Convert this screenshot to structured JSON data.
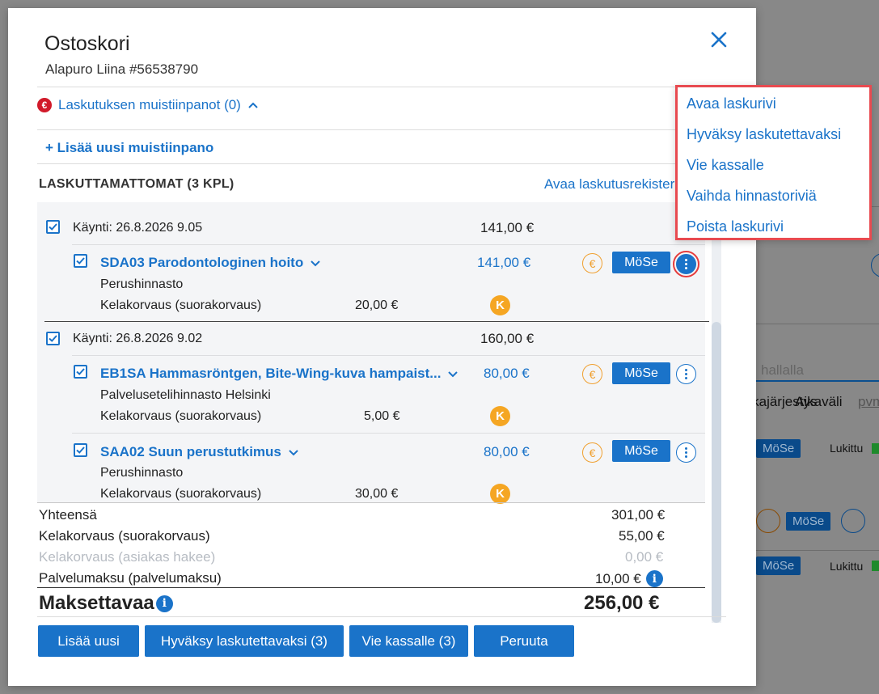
{
  "background": {
    "tabs": [
      "Aikajärjestys",
      "Aikaväli",
      "pvm"
    ],
    "search_partial": "hallalla",
    "locked_label": "Lukittu",
    "mose": "MöSe"
  },
  "modal": {
    "title": "Ostoskori",
    "subtitle": "Alapuro Liina #56538790",
    "notes_toggle": "Laskutuksen muistiinpanot (0)",
    "add_note": "+ Lisää uusi muistiinpano",
    "section_title": "LASKUTTAMATTOMAT (3 KPL)",
    "open_register": "Avaa laskutusrekisteri",
    "visits": [
      {
        "label": "Käynti: 26.8.2026 9.05",
        "total": "141,00 €",
        "items": [
          {
            "title": "SDA03 Parodontologinen hoito",
            "price": "141,00 €",
            "pricelist": "Perushinnasto",
            "kela_label": "Kelakorvaus (suorakorvaus)",
            "kela_amount": "20,00 €",
            "mose": "MöSe"
          }
        ]
      },
      {
        "label": "Käynti: 26.8.2026 9.02",
        "total": "160,00 €",
        "items": [
          {
            "title": "EB1SA Hammasröntgen, Bite-Wing-kuva hampaist...",
            "price": "80,00 €",
            "pricelist": "Palvelusetelihinnasto Helsinki",
            "kela_label": "Kelakorvaus (suorakorvaus)",
            "kela_amount": "5,00 €",
            "mose": "MöSe"
          },
          {
            "title": "SAA02 Suun perustutkimus",
            "price": "80,00 €",
            "pricelist": "Perushinnasto",
            "kela_label": "Kelakorvaus (suorakorvaus)",
            "kela_amount": "30,00 €",
            "mose": "MöSe"
          }
        ]
      }
    ],
    "summary": {
      "total_label": "Yhteensä",
      "total_value": "301,00 €",
      "kela_direct_label": "Kelakorvaus (suorakorvaus)",
      "kela_direct_value": "55,00 €",
      "kela_customer_label": "Kelakorvaus (asiakas hakee)",
      "kela_customer_value": "0,00 €",
      "service_fee_label": "Palvelumaksu (palvelumaksu)",
      "service_fee_value": "10,00 €",
      "payable_label": "Maksettavaa",
      "payable_value": "256,00 €"
    },
    "buttons": {
      "add_new": "Lisää uusi",
      "approve": "Hyväksy laskutettavaksi (3)",
      "checkout": "Vie kassalle (3)",
      "cancel": "Peruuta"
    }
  },
  "context_menu": {
    "items": [
      "Avaa laskurivi",
      "Hyväksy laskutettavaksi",
      "Vie kassalle",
      "Vaihda hinnastoriviä",
      "Poista laskurivi"
    ]
  },
  "icons": {
    "euro": "€",
    "kela": "K",
    "info": "i"
  },
  "colors": {
    "accent": "#1a73c9",
    "euro_orange": "#f0a030",
    "alert_red": "#d11a2a",
    "highlight_red": "#e84a50"
  }
}
